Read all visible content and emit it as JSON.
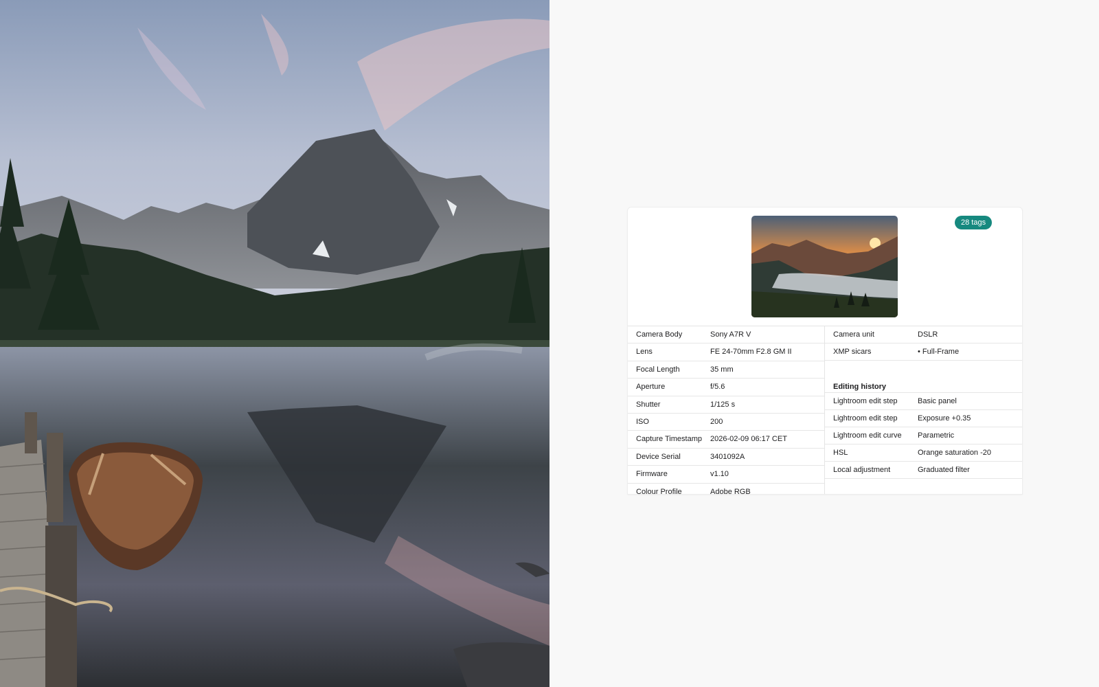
{
  "metadata": {
    "tag_count": "28 tags",
    "left_rows": [
      {
        "label": "Camera Body",
        "value": "Sony A7R V"
      },
      {
        "label": "Lens",
        "value": "FE 24-70mm F2.8 GM II"
      },
      {
        "label": "Focal Length",
        "value": "35 mm"
      },
      {
        "label": "Aperture",
        "value": "f/5.6"
      },
      {
        "label": "Shutter",
        "value": "1/125 s"
      },
      {
        "label": "ISO",
        "value": "200"
      },
      {
        "label": "Capture Timestamp",
        "value": "2026-02-09 06:17 CET"
      },
      {
        "label": "Device Serial",
        "value": "3401092A"
      },
      {
        "label": "Firmware",
        "value": "v1.10"
      },
      {
        "label": "Colour Profile",
        "value": "Adobe RGB"
      }
    ],
    "right_rows": [
      {
        "label": "Camera unit",
        "value": "DSLR"
      },
      {
        "label": "XMP sicars",
        "value": "• Full-Frame"
      }
    ],
    "editing_history": {
      "title": "Editing history",
      "rows": [
        {
          "label": "Lightroom edit step",
          "value": "Basic panel"
        },
        {
          "label": "Lightroom edit step",
          "value": "Exposure +0.35"
        },
        {
          "label": "Lightroom edit curve",
          "value": "Parametric"
        },
        {
          "label": "HSL",
          "value": "Orange saturation -20"
        },
        {
          "label": "Local adjustment",
          "value": "Graduated filter"
        }
      ]
    }
  },
  "colors": {
    "badge": "#16897f",
    "background": "#f8f8f8",
    "card": "#ffffff"
  }
}
